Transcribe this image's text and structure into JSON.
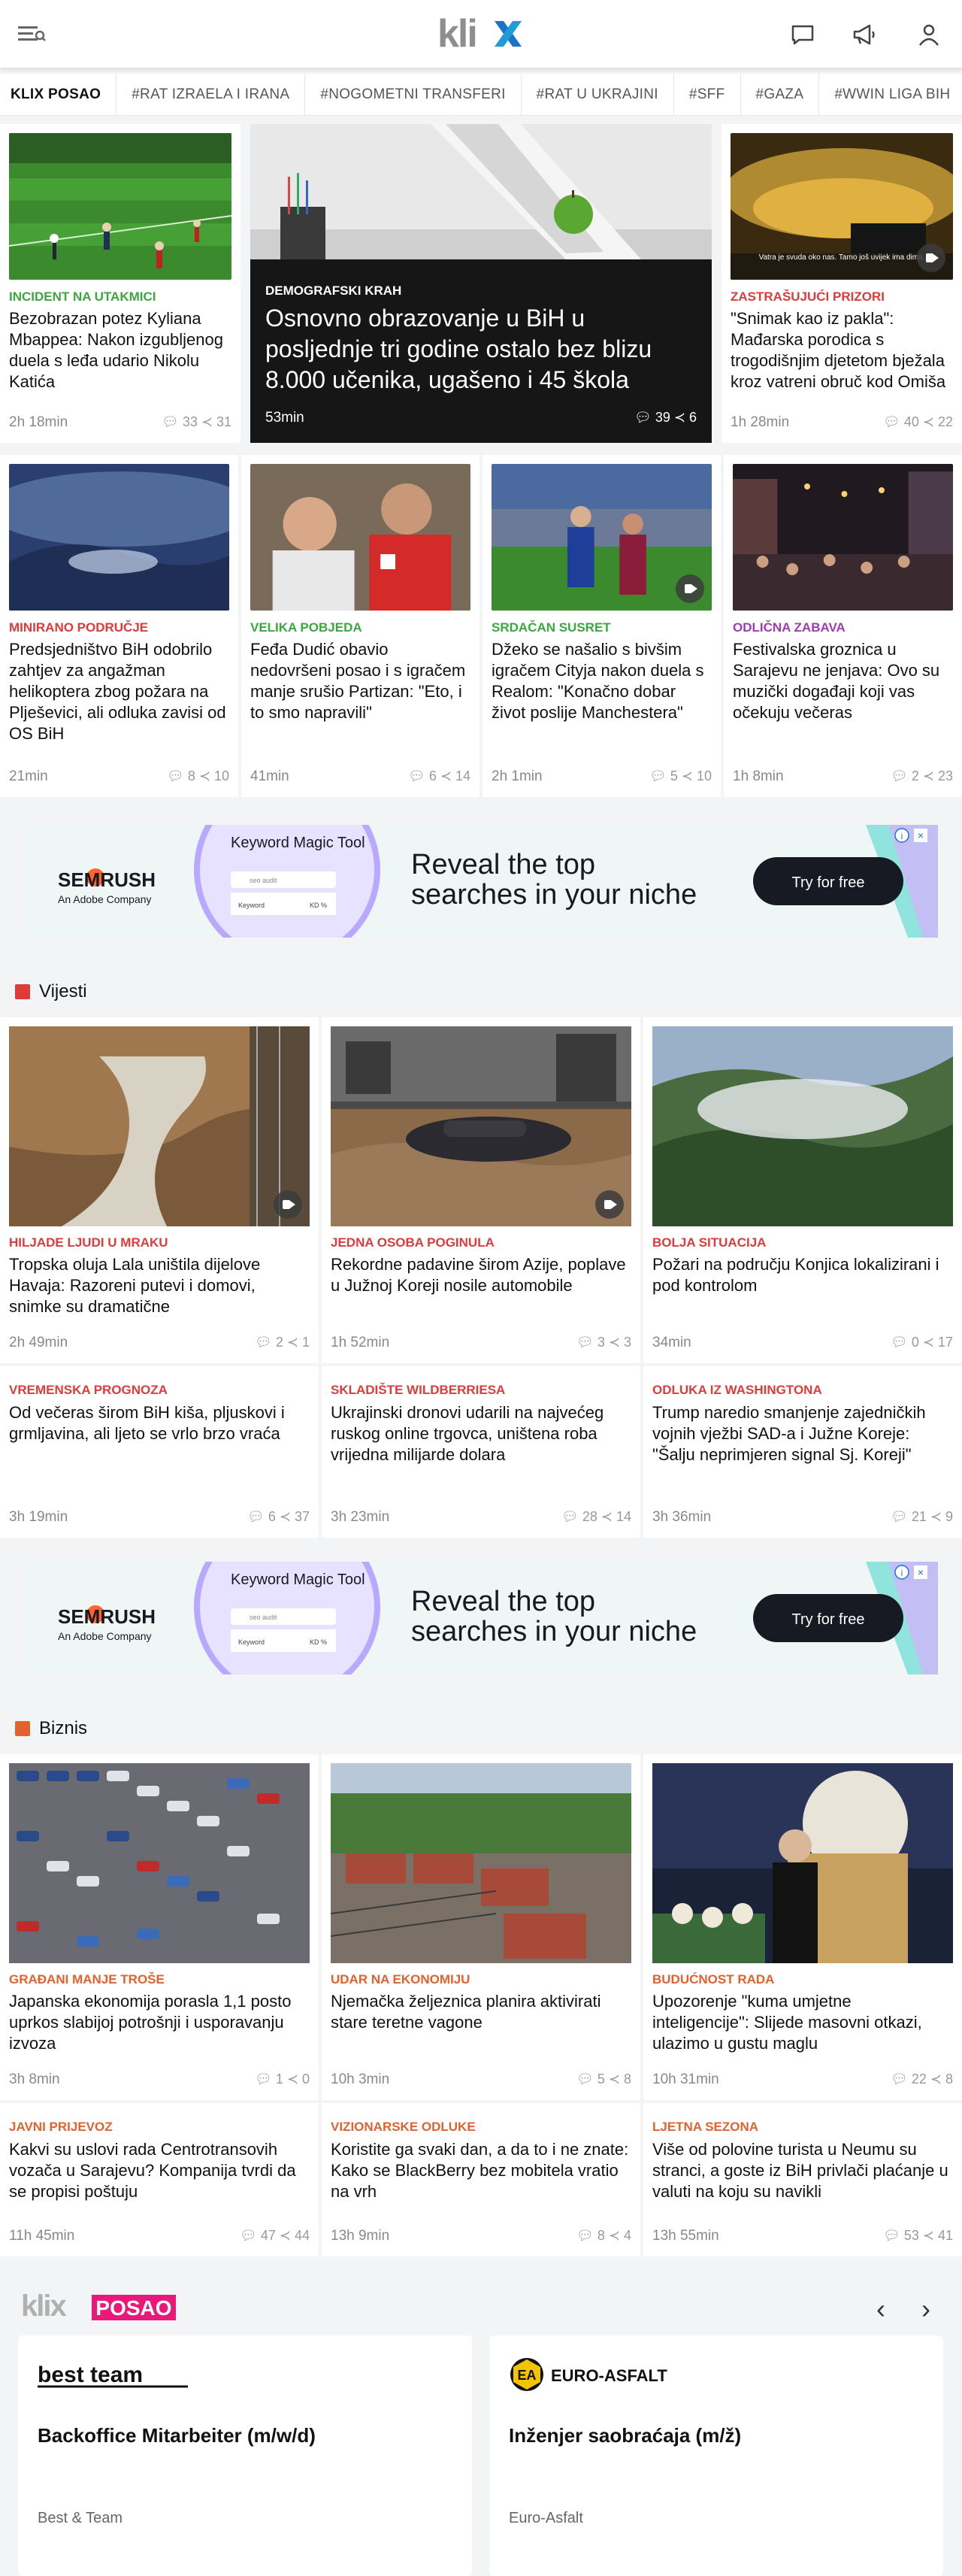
{
  "header": {
    "logo": "klix",
    "menu_icon": "menu-icon",
    "icons": [
      "chat-icon",
      "megaphone-icon",
      "user-icon"
    ]
  },
  "tags": [
    "KLIX POSAO",
    "#RAT IZRAELA I IRANA",
    "#NOGOMETNI TRANSFERI",
    "#RAT U UKRAJINI",
    "#SFF",
    "#GAZA",
    "#WWIN LIGA BIH"
  ],
  "colors": {
    "green": "#3aa83f",
    "red": "#e03a3a",
    "purple": "#a03bb5",
    "orange": "#e0622f",
    "pink": "#e8197a"
  },
  "top": [
    {
      "category": "Incident na utakmici",
      "title": "Bezobrazan potez Kyliana Mbappea: Nakon izgubljenog duela s leđa udario Nikolu Katića",
      "time": "2h 18min",
      "comments": "33",
      "shares": "31"
    },
    {
      "category": "Demografski krah",
      "title": "Osnovno obrazovanje u BiH u posljednje tri godine ostalo bez blizu 8.000 učenika, ugašeno i 45 škola",
      "time": "53min",
      "comments": "39",
      "shares": "6"
    },
    {
      "category": "Zastrašujući prizori",
      "title": "\"Snimak kao iz pakla\": Mađarska porodica s trogodišnjim djetetom bježala kroz vatreni obruč kod Omiša",
      "time": "1h 28min",
      "comments": "40",
      "shares": "22",
      "caption": "Vatra je svuda oko nas. Tamo još uvijek ima dima."
    },
    {
      "category": "Minirano područje",
      "title": "Predsjedništvo BiH odobrilo zahtjev za angažman helikoptera zbog požara na Plješevici, ali odluka zavisi od OS BiH",
      "time": "21min",
      "comments": "8",
      "shares": "10"
    },
    {
      "category": "Velika pobjeda",
      "title": "Feđa Dudić obavio nedovršeni posao i s igračem manje srušio Partizan: \"Eto, i to smo napravili\"",
      "time": "41min",
      "comments": "6",
      "shares": "14"
    },
    {
      "category": "Srdačan susret",
      "title": "Džeko se našalio s bivšim igračem Cityja nakon duela s Realom: \"Konačno dobar život poslije Manchestera\"",
      "time": "2h 1min",
      "comments": "5",
      "shares": "10"
    },
    {
      "category": "Odlična zabava",
      "title": "Festivalska groznica u Sarajevu ne jenjava: Ovo su muzički događaji koji vas očekuju večeras",
      "time": "1h 8min",
      "comments": "2",
      "shares": "23"
    }
  ],
  "ad": {
    "brand": "SEMRUSH",
    "sub": "An Adobe Company",
    "tool_title": "Keyword Magic Tool",
    "tool_field": "seo audit",
    "tool_keyword": "Keyword",
    "tool_kd": "KD %",
    "headline_1": "Reveal the top",
    "headline_2": "searches in your niche",
    "cta": "Try for free"
  },
  "vijesti": {
    "title": "Vijesti",
    "items": [
      {
        "category": "Hiljade ljudi u mraku",
        "title": "Tropska oluja Lala uništila dijelove Havaja: Razoreni putevi i domovi, snimke su dramatične",
        "time": "2h 49min",
        "comments": "2",
        "shares": "1"
      },
      {
        "category": "Jedna osoba poginula",
        "title": "Rekordne padavine širom Azije, poplave u Južnoj Koreji nosile automobile",
        "time": "1h 52min",
        "comments": "3",
        "shares": "3"
      },
      {
        "category": "Bolja situacija",
        "title": "Požari na području Konjica lokalizirani i pod kontrolom",
        "time": "34min",
        "comments": "0",
        "shares": "17"
      },
      {
        "category": "Vremenska prognoza",
        "title": "Od večeras širom BiH kiša, pljuskovi i grmljavina, ali ljeto se vrlo brzo vraća",
        "time": "3h 19min",
        "comments": "6",
        "shares": "37"
      },
      {
        "category": "Skladište Wildberriesa",
        "title": "Ukrajinski dronovi udarili na najvećeg ruskog online trgovca, uništena roba vrijedna milijarde dolara",
        "time": "3h 23min",
        "comments": "28",
        "shares": "14"
      },
      {
        "category": "Odluka iz Washingtona",
        "title": "Trump naredio smanjenje zajedničkih vojnih vježbi SAD-a i Južne Koreje: \"Šalju neprimjeren signal Sj. Koreji\"",
        "time": "3h 36min",
        "comments": "21",
        "shares": "9"
      }
    ]
  },
  "biznis": {
    "title": "Biznis",
    "items": [
      {
        "category": "Građani manje troše",
        "title": "Japanska ekonomija porasla 1,1 posto uprkos slabijoj potrošnji i usporavanju izvoza",
        "time": "3h 8min",
        "comments": "1",
        "shares": "0"
      },
      {
        "category": "Udar na ekonomiju",
        "title": "Njemačka željeznica planira aktivirati stare teretne vagone",
        "time": "10h 3min",
        "comments": "5",
        "shares": "8"
      },
      {
        "category": "Budućnost rada",
        "title": "Upozorenje \"kuma umjetne inteligencije\": Slijede masovni otkazi, ulazimo u gustu maglu",
        "time": "10h 31min",
        "comments": "22",
        "shares": "8"
      },
      {
        "category": "Javni prijevoz",
        "title": "Kakvi su uslovi rada Centrotransovih vozača u Sarajevu? Kompanija tvrdi da se propisi poštuju",
        "time": "11h 45min",
        "comments": "47",
        "shares": "44"
      },
      {
        "category": "Vizionarske odluke",
        "title": "Koristite ga svaki dan, a da to i ne znate: Kako se BlackBerry bez mobitela vratio na vrh",
        "time": "13h 9min",
        "comments": "8",
        "shares": "4"
      },
      {
        "category": "Ljetna sezona",
        "title": "Više od polovine turista u Neumu su stranci, a goste iz BiH privlači plaćanje u valuti na koju su navikli",
        "time": "13h 55min",
        "comments": "53",
        "shares": "41"
      }
    ]
  },
  "posao": {
    "logo_1": "klix",
    "logo_2": "POSAO",
    "prev": "‹",
    "next": "›",
    "jobs": [
      {
        "company_logo": "best team",
        "title": "Backoffice Mitarbeiter (m/w/d)",
        "company": "Best & Team"
      },
      {
        "company_logo": "EURO-ASFALT",
        "badge": "EA",
        "title": "Inženjer saobraćaja (m/ž)",
        "company": "Euro-Asfalt"
      }
    ]
  }
}
